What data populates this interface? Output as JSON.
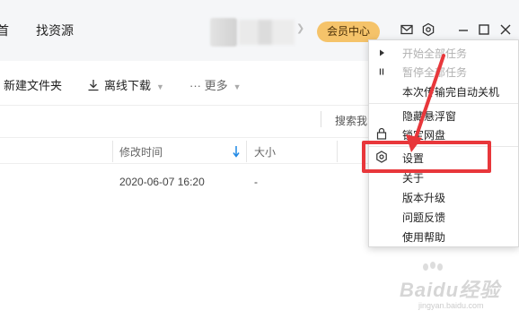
{
  "nav": {
    "partial_label": "首",
    "find_resources": "找资源"
  },
  "header": {
    "vip_center": "会员中心"
  },
  "toolbar": {
    "new_folder": "新建文件夹",
    "offline_download": "离线下载",
    "more": "··· 更多"
  },
  "search": {
    "partial": "搜索我"
  },
  "table": {
    "columns": [
      "修改时间",
      "大小"
    ],
    "rows": [
      {
        "modified": "2020-06-07 16:20",
        "size": "-"
      }
    ]
  },
  "menu": {
    "items": [
      {
        "label": "开始全部任务",
        "disabled": true,
        "icon": "play-icon"
      },
      {
        "label": "暂停全部任务",
        "disabled": true,
        "icon": "pause-icon"
      },
      {
        "label": "本次传输完自动关机",
        "disabled": false
      },
      {
        "label": "隐藏悬浮窗",
        "disabled": false
      },
      {
        "label": "锁定网盘",
        "disabled": false,
        "icon": "lock-icon"
      },
      {
        "label": "设置",
        "disabled": false,
        "icon": "gear-icon",
        "highlighted": true
      },
      {
        "label": "关于",
        "disabled": false
      },
      {
        "label": "版本升级",
        "disabled": false
      },
      {
        "label": "问题反馈",
        "disabled": false
      },
      {
        "label": "使用帮助",
        "disabled": false
      }
    ]
  },
  "watermark": {
    "text": "Baidu经验",
    "sub": "jingyan.baidu.com"
  },
  "colors": {
    "vip_bg": "#f5c36a",
    "highlight_red": "#e8373b",
    "sort_arrow": "#1e88e5"
  }
}
